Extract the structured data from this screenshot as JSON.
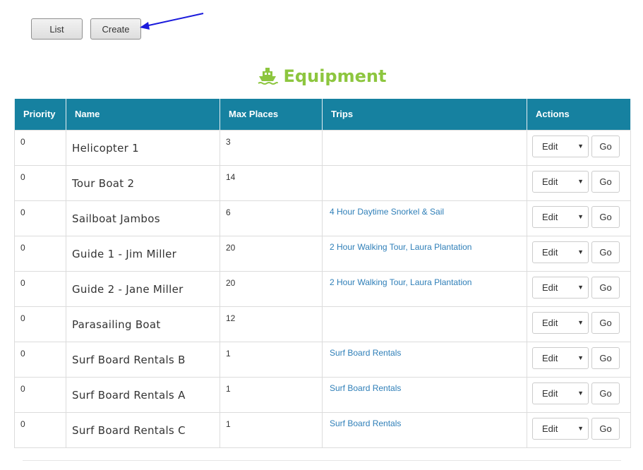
{
  "toolbar": {
    "list_label": "List",
    "create_label": "Create"
  },
  "page": {
    "title": "Equipment",
    "title_icon": "ship-icon",
    "title_color": "#8dc63f",
    "header_color": "#1681a0",
    "link_color": "#2f7fb8",
    "annotation_arrow_color": "#1a1adc"
  },
  "table": {
    "headers": [
      "Priority",
      "Name",
      "Max Places",
      "Trips",
      "Actions"
    ],
    "select_label": "Edit",
    "go_label": "Go",
    "rows": [
      {
        "priority": "0",
        "name": "Helicopter 1",
        "max_places": "3",
        "trips": ""
      },
      {
        "priority": "0",
        "name": "Tour Boat 2",
        "max_places": "14",
        "trips": ""
      },
      {
        "priority": "0",
        "name": "Sailboat Jambos",
        "max_places": "6",
        "trips": "4 Hour Daytime Snorkel & Sail"
      },
      {
        "priority": "0",
        "name": "Guide 1 - Jim Miller",
        "max_places": "20",
        "trips": "2 Hour Walking Tour, Laura Plantation"
      },
      {
        "priority": "0",
        "name": "Guide 2 - Jane Miller",
        "max_places": "20",
        "trips": "2 Hour Walking Tour, Laura Plantation"
      },
      {
        "priority": "0",
        "name": "Parasailing Boat",
        "max_places": "12",
        "trips": ""
      },
      {
        "priority": "0",
        "name": "Surf Board Rentals B",
        "max_places": "1",
        "trips": "Surf Board Rentals"
      },
      {
        "priority": "0",
        "name": "Surf Board Rentals A",
        "max_places": "1",
        "trips": "Surf Board Rentals"
      },
      {
        "priority": "0",
        "name": "Surf Board Rentals C",
        "max_places": "1",
        "trips": "Surf Board Rentals"
      }
    ]
  }
}
